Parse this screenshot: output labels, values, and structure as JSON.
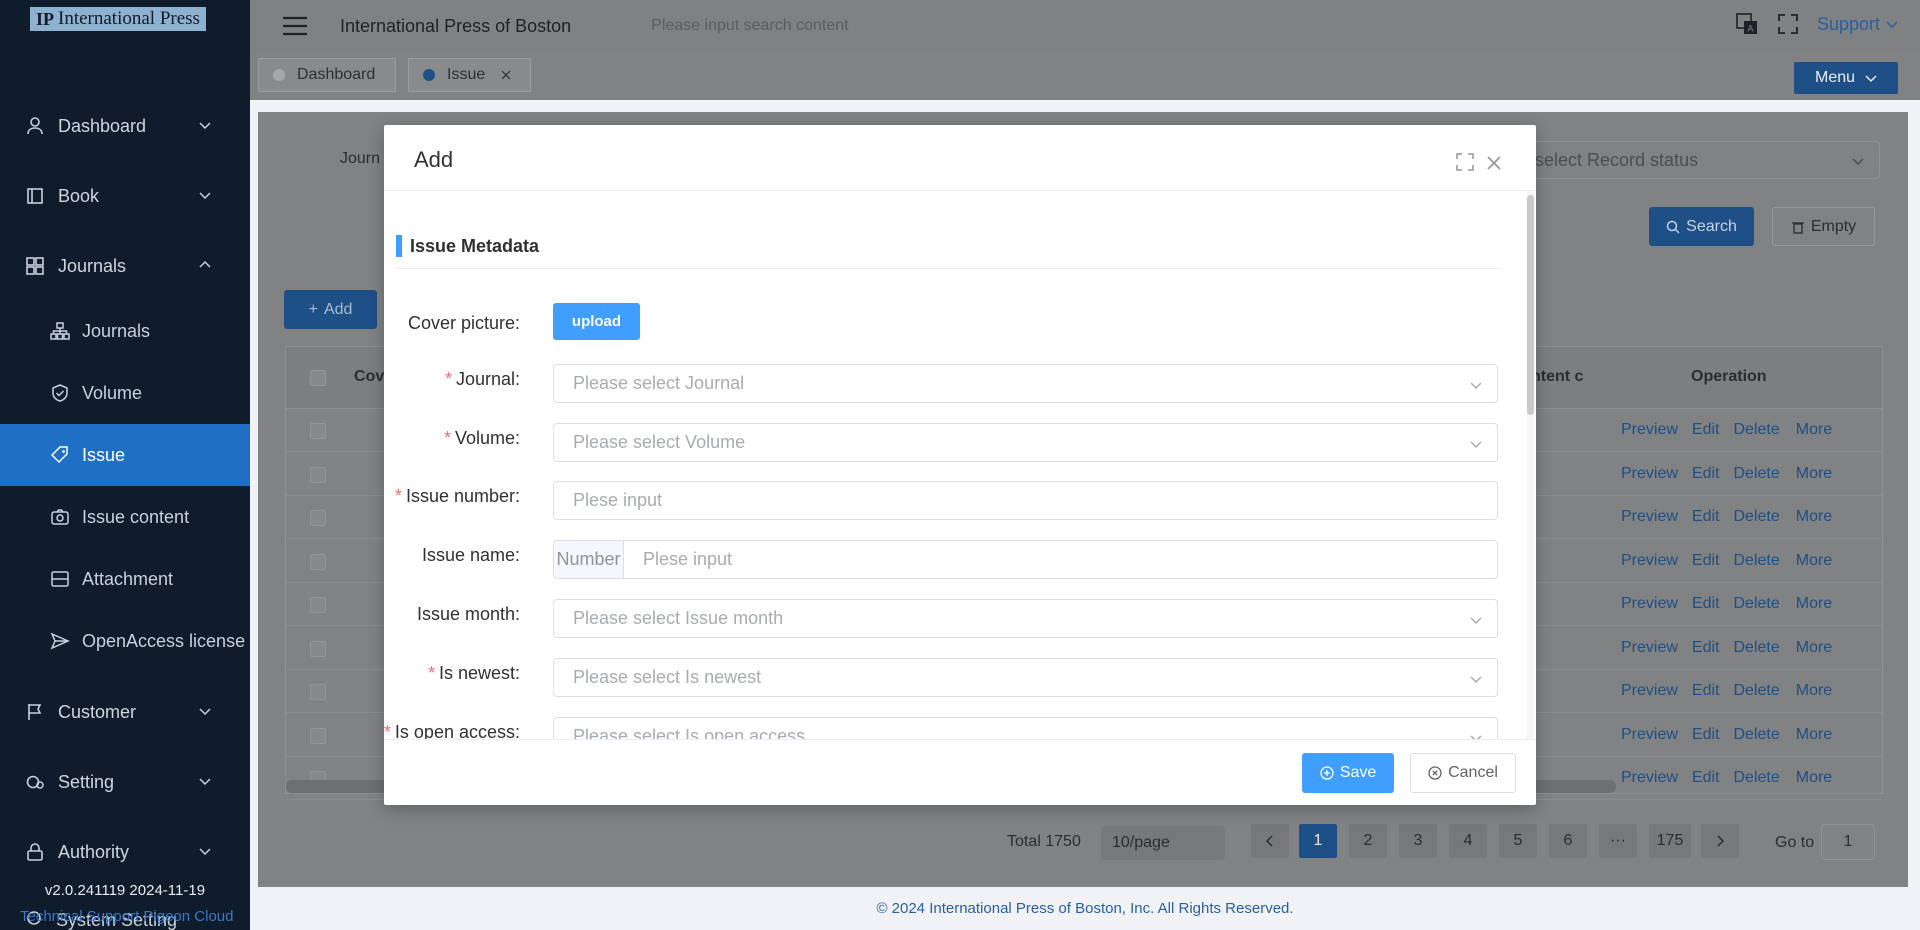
{
  "sidebar": {
    "logo_mark": "IP",
    "logo_text": "International Press",
    "groups": {
      "dashboard": "Dashboard",
      "book": "Book",
      "journals": "Journals",
      "customer": "Customer",
      "setting": "Setting",
      "authority": "Authority",
      "system": "System Setting"
    },
    "subitems": {
      "journals": "Journals",
      "volume": "Volume",
      "issue": "Issue",
      "issue_content": "Issue content",
      "attachment": "Attachment",
      "openaccess": "OpenAccess license"
    },
    "version": "v2.0.241119 2024-11-19",
    "tech_support": "Technical Support Pigeon Cloud"
  },
  "header": {
    "site_title": "International Press of Boston",
    "search_placeholder": "Please input search content",
    "support_label": "Support"
  },
  "tabs": {
    "dashboard": "Dashboard",
    "issue": "Issue",
    "menu_label": "Menu"
  },
  "background": {
    "filter_label": "Journ",
    "record_status_placeholder": "se select Record status",
    "search_btn": "Search",
    "empty_btn": "Empty",
    "add_btn": "Add",
    "col_cover": "Cove",
    "col_content": "ntent c",
    "col_operation": "Operation",
    "ops": [
      "Preview",
      "Edit",
      "Delete",
      "More"
    ],
    "total": "Total 1750",
    "page_size": "10/page",
    "pages": [
      "1",
      "2",
      "3",
      "4",
      "5",
      "6",
      "···",
      "175"
    ],
    "goto_label": "Go to",
    "goto_value": "1",
    "footer": "© 2024 International Press of Boston, Inc. All Rights Reserved."
  },
  "dialog": {
    "title": "Add",
    "section": "Issue Metadata",
    "cover_label": "Cover picture:",
    "upload": "upload",
    "journal_label": "Journal:",
    "journal_ph": "Please select Journal",
    "volume_label": "Volume:",
    "volume_ph": "Please select Volume",
    "issue_number_label": "Issue number:",
    "issue_number_ph": "Plese input",
    "issue_name_label": "Issue name:",
    "issue_name_prepend": "Number",
    "issue_name_ph": "Plese input",
    "issue_month_label": "Issue month:",
    "issue_month_ph": "Please select Issue month",
    "is_newest_label": "Is newest:",
    "is_newest_ph": "Please select Is newest",
    "is_open_label": "Is open access:",
    "is_open_ph": "Please select Is open access",
    "save": "Save",
    "cancel": "Cancel"
  }
}
